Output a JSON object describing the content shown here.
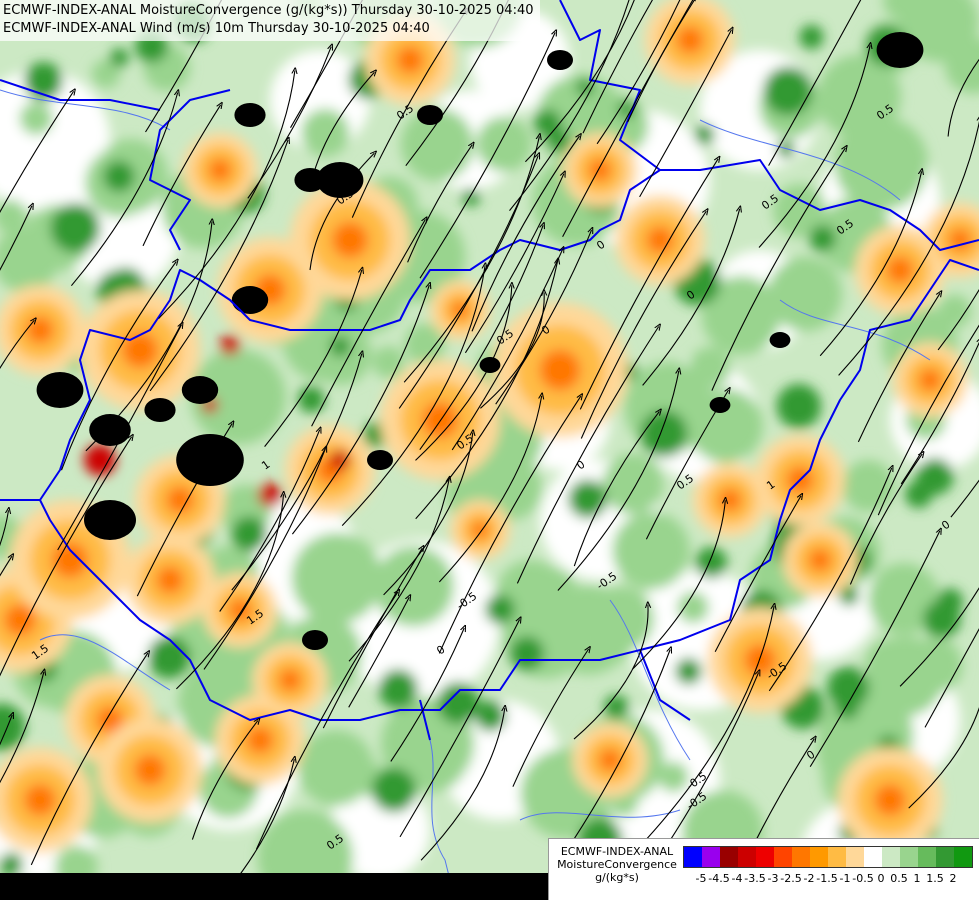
{
  "header": {
    "line1": "ECMWF-INDEX-ANAL MoistureConvergence (g/(kg*s)) Thursday 30-10-2025 04:40",
    "line2": "ECMWF-INDEX-ANAL Wind (m/s) 10m Thursday 30-10-2025 04:40"
  },
  "legend": {
    "title_lines": [
      "ECMWF-INDEX-ANAL",
      "MoistureConvergence",
      "g/(kg*s)"
    ],
    "colors": [
      "#0000ff",
      "#9900ee",
      "#990000",
      "#cc0000",
      "#ee0000",
      "#ff4400",
      "#ff7700",
      "#ff9900",
      "#ffbb44",
      "#ffd899",
      "#ffffff",
      "#cce9c4",
      "#99d48e",
      "#66bb5c",
      "#339933",
      "#119911"
    ],
    "tick_labels": [
      "-5",
      "-4.5",
      "-4",
      "-3.5",
      "-3",
      "-2.5",
      "-2",
      "-1.5",
      "-1",
      "-0.5",
      "0",
      "0.5",
      "1",
      "1.5",
      "2"
    ]
  },
  "map": {
    "contour_labels": [
      "0.5",
      "0",
      "-0.5",
      "1",
      "1.5",
      "0.5",
      "0",
      "-0.5",
      "0.5",
      "0",
      "1.5",
      "0.5",
      "0",
      "-0.5",
      "0.5",
      "0",
      "0.5",
      "1",
      "0.5",
      "-0.5",
      "0.5",
      "0",
      "0.5",
      "-0.5",
      "0"
    ],
    "colors": {
      "border": "#0000ee",
      "river": "#5577ee",
      "streamline": "#000000",
      "dry_strong": "#000000",
      "conv_light": "#cce9c4",
      "conv_mid": "#99d48e",
      "conv_high": "#339933",
      "div_light": "#ffd899",
      "div_mid": "#ffbb44",
      "div_high": "#ff7700",
      "div_extreme": "#cc0000"
    }
  }
}
